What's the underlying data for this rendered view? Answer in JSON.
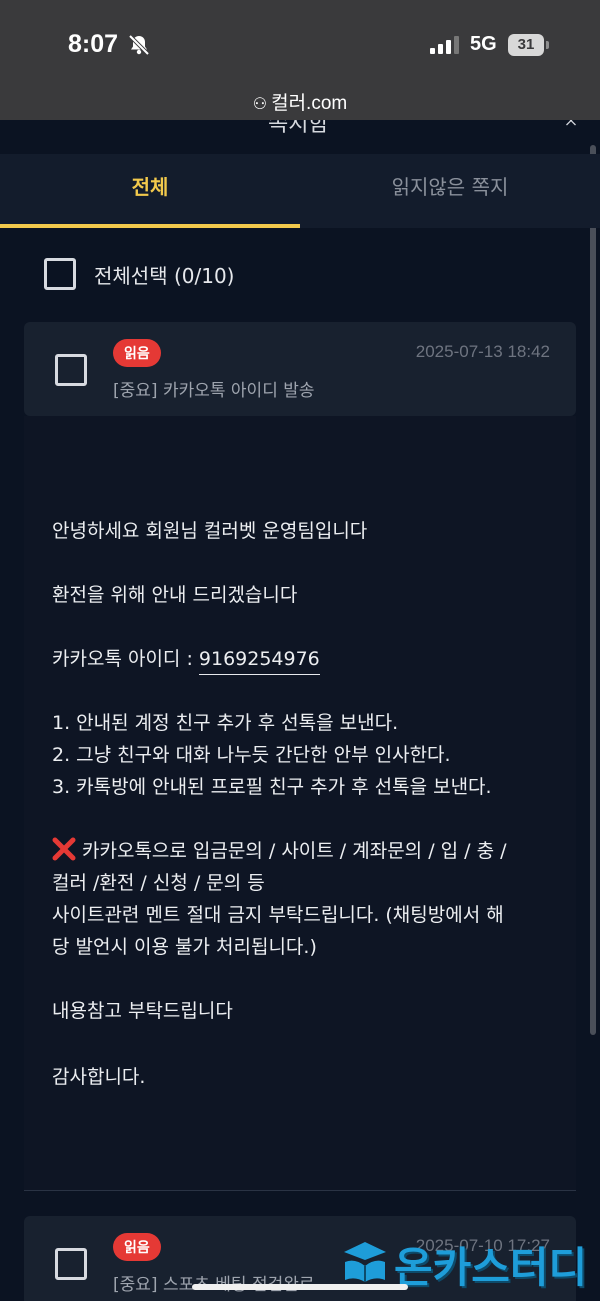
{
  "status_bar": {
    "time": "8:07",
    "network": "5G",
    "battery": "31"
  },
  "browser": {
    "url": "컬러.com"
  },
  "header": {
    "title_partial": "쪽지함"
  },
  "tabs": [
    {
      "label": "전체"
    },
    {
      "label": "읽지않은 쪽지"
    }
  ],
  "select_all": {
    "label": "전체선택 (0/10)"
  },
  "messages": [
    {
      "badge": "읽음",
      "date": "2025-07-13 18:42",
      "title": "[중요] 카카오톡 아이디 발송",
      "body": {
        "greeting": "안녕하세요 회원님 컬러벳 운영팀입니다",
        "intro": "환전을 위해 안내 드리겠습니다",
        "kakao_label": "카카오톡 아이디 : ",
        "kakao_id": "9169254976",
        "steps": [
          "1. 안내된 계정 친구 추가 후 선톡을 보낸다.",
          "2. 그냥 친구와 대화 나누듯 간단한 안부 인사한다.",
          "3. 카톡방에 안내된 프로필 친구 추가 후 선톡을 보낸다."
        ],
        "warning_lines": [
          "카카오톡으로 입금문의 / 사이트 / 계좌문의 / 입 / 충 /",
          "컬러 /환전 / 신청 / 문의 등",
          "사이트관련 멘트 절대 금지 부탁드립니다. (채팅방에서 해",
          "당 발언시 이용 불가 처리됩니다.)"
        ],
        "closing": "내용참고 부탁드립니다",
        "thanks": "감사합니다."
      }
    },
    {
      "badge": "읽음",
      "date": "2025-07-10 17:27",
      "title": "[중요] 스포츠 베팅 점검완료"
    }
  ],
  "watermark": {
    "text": "온카스터디"
  },
  "colors": {
    "accent": "#f2c94c",
    "badge": "#e53935",
    "background": "#0b1322"
  }
}
